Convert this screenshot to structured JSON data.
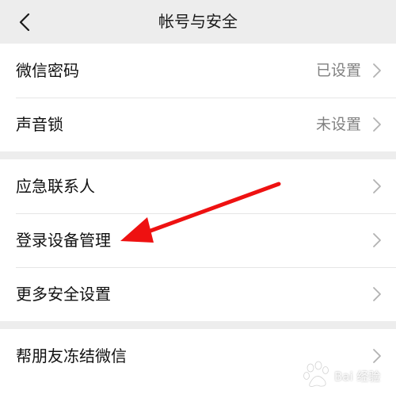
{
  "header": {
    "title": "帐号与安全"
  },
  "groups": [
    {
      "items": [
        {
          "label": "微信密码",
          "value": "已设置"
        },
        {
          "label": "声音锁",
          "value": "未设置"
        }
      ]
    },
    {
      "items": [
        {
          "label": "应急联系人"
        },
        {
          "label": "登录设备管理"
        },
        {
          "label": "更多安全设置"
        }
      ]
    },
    {
      "items": [
        {
          "label": "帮朋友冻结微信"
        }
      ]
    }
  ],
  "watermark": {
    "text": "Bai 经验"
  },
  "colors": {
    "annotation_arrow": "#ee1111",
    "background": "#ededed",
    "row_background": "#ffffff",
    "secondary_text": "#808080"
  }
}
